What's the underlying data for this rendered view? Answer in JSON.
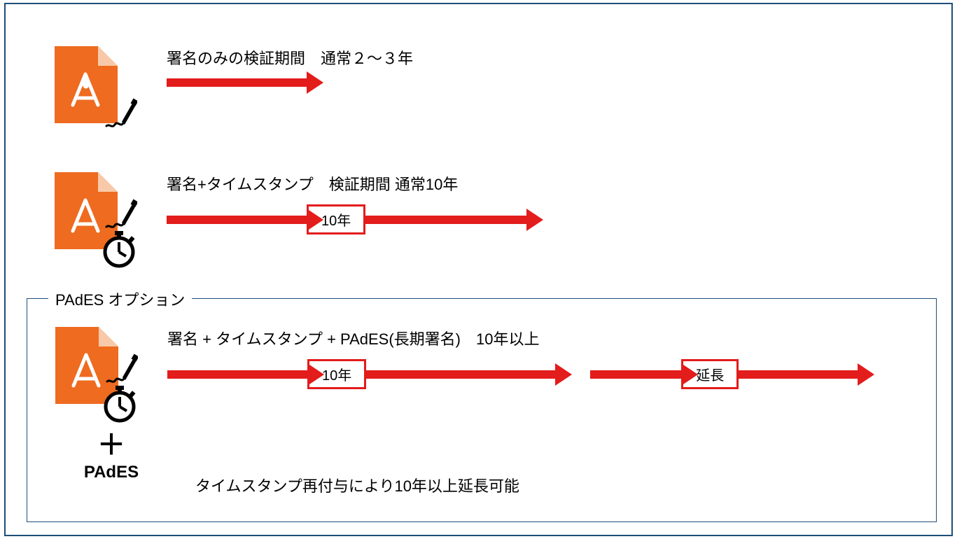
{
  "row1": {
    "title": "署名のみの検証期間　通常２～３年"
  },
  "row2": {
    "title": "署名+タイムスタンプ　検証期間 通常10年",
    "badge": "10年"
  },
  "pades": {
    "legend": "PAdES オプション",
    "title": "署名 + タイムスタンプ + PAdES(長期署名)　10年以上",
    "badge1": "10年",
    "badge2": "延長",
    "plus": "＋",
    "label": "PAdES",
    "footnote": "タイムスタンプ再付与により10年以上延長可能"
  }
}
